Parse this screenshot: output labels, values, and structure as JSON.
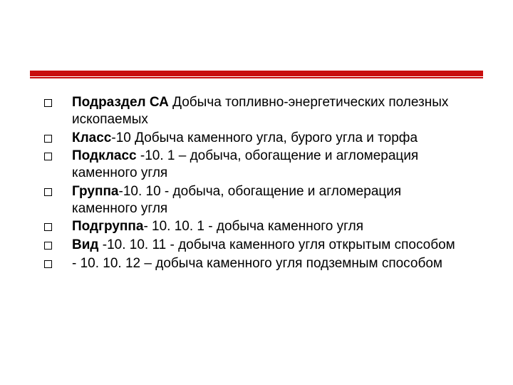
{
  "accent_color": "#c90e0e",
  "items": [
    {
      "bold": "Подраздел СА",
      "rest": " Добыча топливно-энергетических полезных ископаемых"
    },
    {
      "bold": "Класс",
      "rest": "-10 Добыча каменного угла, бурого угла и торфа"
    },
    {
      "bold": "Подкласс",
      "rest": " -10. 1 – добыча, обогащение и агломерация каменного угля"
    },
    {
      "bold": "Группа",
      "rest": "-10. 10 - добыча, обогащение и агломерация каменного угля"
    },
    {
      "bold": "Подгруппа",
      "rest": "- 10. 10. 1 - добыча каменного угля"
    },
    {
      "bold": "Вид",
      "rest": " -10. 10. 11 - добыча каменного угля открытым способом"
    },
    {
      "bold": "",
      "rest": "- 10. 10. 12 – добыча каменного угля подземным способом"
    }
  ]
}
